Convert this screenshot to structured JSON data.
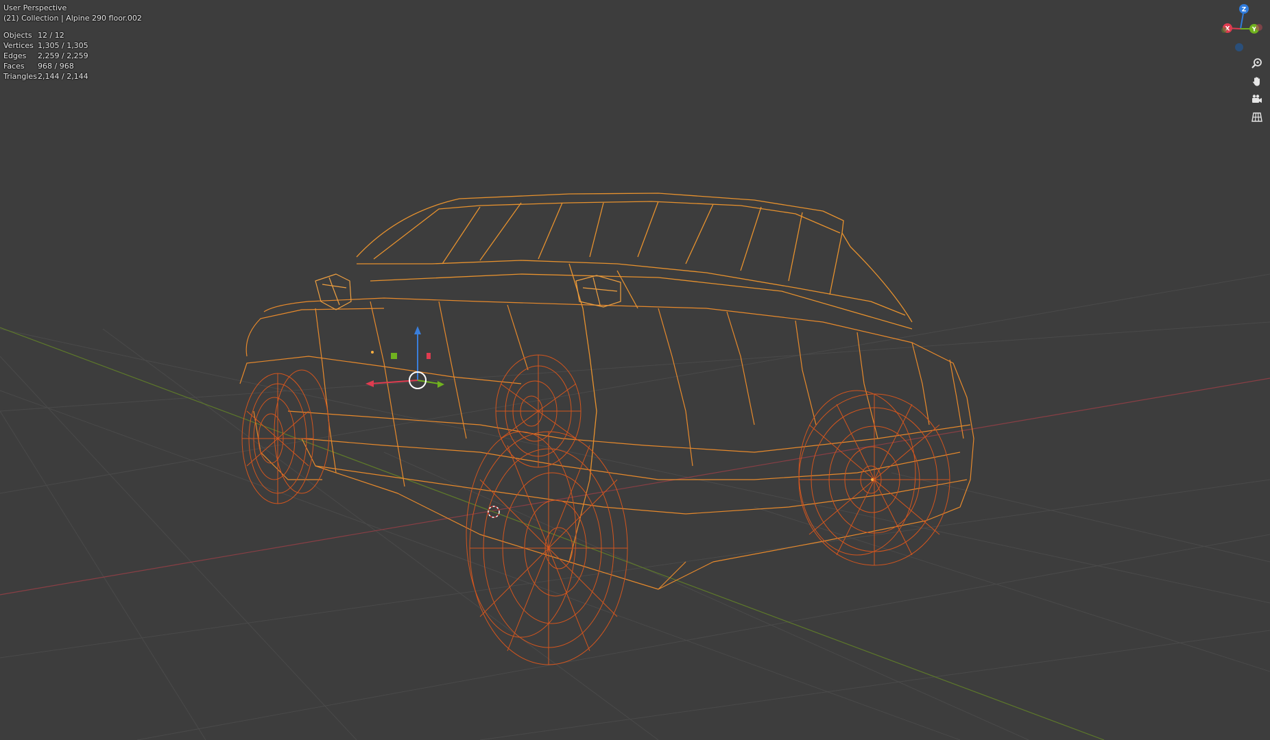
{
  "viewport": {
    "view_name": "User Perspective",
    "collection_info": "(21) Collection | Alpine 290 floor.002",
    "stats": [
      {
        "label": "Objects",
        "value": "12 / 12"
      },
      {
        "label": "Vertices",
        "value": "1,305 / 1,305"
      },
      {
        "label": "Edges",
        "value": "2,259 / 2,259"
      },
      {
        "label": "Faces",
        "value": "968 / 968"
      },
      {
        "label": "Triangles",
        "value": "2,144 / 2,144"
      }
    ]
  },
  "gizmo": {
    "axes": [
      {
        "axis": "Z",
        "color": "#2f7bdc"
      },
      {
        "axis": "X",
        "color": "#e03c50"
      },
      {
        "axis": "Y",
        "color": "#70b21f"
      }
    ],
    "negative_axis_color": "#2a4f7a"
  },
  "nav_buttons": [
    {
      "icon": "zoom-icon"
    },
    {
      "icon": "hand-pan-icon"
    },
    {
      "icon": "camera-view-icon"
    },
    {
      "icon": "grid-ortho-icon"
    }
  ],
  "colors": {
    "background": "#3d3d3d",
    "grid": "#4c4c4c",
    "x_axis_line": "#8a3f45",
    "y_axis_line": "#5e7a2a",
    "wire_light": "#e8922e",
    "wire_dark": "#d4521e"
  }
}
